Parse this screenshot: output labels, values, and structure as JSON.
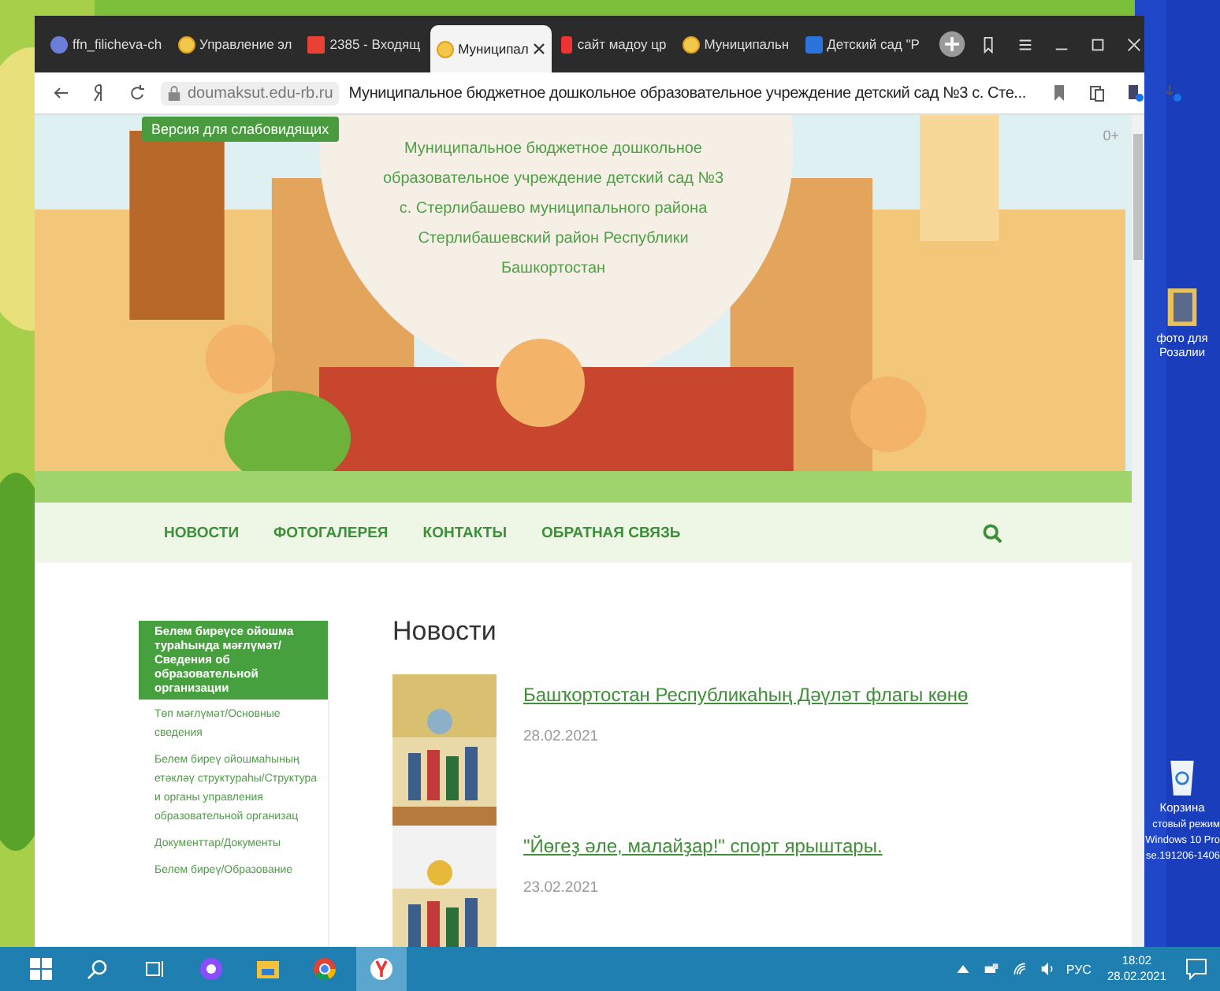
{
  "browser": {
    "tabs": [
      {
        "title": "ffn_filicheva-ch",
        "kind": "globe",
        "selected": false
      },
      {
        "title": "Управление эл",
        "kind": "ball",
        "selected": false
      },
      {
        "title": "2385 - Входящ",
        "kind": "mail",
        "selected": false
      },
      {
        "title": "Муниципал",
        "kind": "ball",
        "selected": true
      },
      {
        "title": "сайт мадоу цр",
        "kind": "red",
        "selected": false
      },
      {
        "title": "Муниципальн",
        "kind": "ball",
        "selected": false
      },
      {
        "title": "Детский сад \"Р",
        "kind": "blue",
        "selected": false
      }
    ],
    "address": {
      "domain": "doumaksut.edu-rb.ru",
      "page_title": "Муниципальное бюджетное дошкольное образовательное учреждение детский сад №3 с. Сте..."
    }
  },
  "site": {
    "accessibility_button": "Версия для слабовидящих",
    "age_rating": "0+",
    "org_name": [
      "Муниципальное бюджетное дошкольное",
      "образовательное учреждение детский сад №3",
      "с. Стерлибашево муниципального района",
      "Стерлибашевский район Республики",
      "Башкортостан"
    ],
    "nav": [
      "НОВОСТИ",
      "ФОТОГАЛЕРЕЯ",
      "КОНТАКТЫ",
      "ОБРАТНАЯ СВЯЗЬ"
    ],
    "sidebar": {
      "heading": "Белем биреүсе ойошма тураһында мәғлүмәт/ Сведения об образовательной организации",
      "items": [
        "Төп мәғлүмәт/Основные сведения",
        "Белем биреү ойошмаһының етәкләү структураһы/Структура и органы управления образовательной организац",
        "Документтар/Документы",
        "Белем биреү/Образование"
      ]
    },
    "news": {
      "title": "Новости",
      "items": [
        {
          "title": "Башҡортостан Республикаһың Дәүләт флагы көнө",
          "date": "28.02.2021"
        },
        {
          "title": "\"Йөгеҙ әле, малайҙар!\" спорт ярыштары.",
          "date": "23.02.2021"
        }
      ]
    }
  },
  "desktop": {
    "icons": [
      {
        "label": "фото для Розалии",
        "kind": "folder"
      },
      {
        "label": "Корзина",
        "kind": "recycle-bin"
      }
    ],
    "watermark": [
      "стовый режим",
      "Windows 10 Pro",
      "se.191206-1406"
    ]
  },
  "taskbar": {
    "apps": [
      {
        "kind": "start",
        "active": false
      },
      {
        "kind": "search",
        "active": false
      },
      {
        "kind": "task-view",
        "active": false
      },
      {
        "kind": "alice",
        "active": false
      },
      {
        "kind": "explorer",
        "active": false
      },
      {
        "kind": "chrome",
        "active": false
      },
      {
        "kind": "yandex",
        "active": true
      }
    ],
    "language": "РУС",
    "time": "18:02",
    "date": "28.02.2021"
  }
}
